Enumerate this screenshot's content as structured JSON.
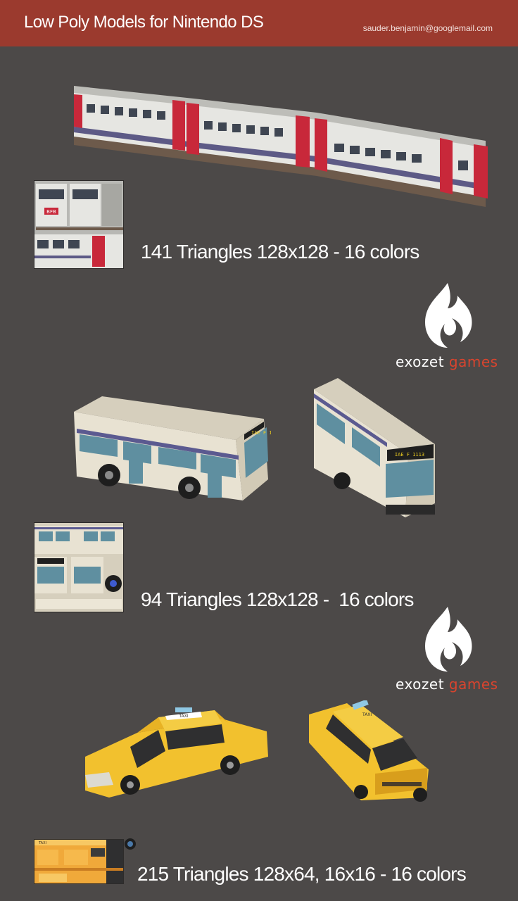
{
  "header": {
    "title": "Low Poly Models for Nintendo DS",
    "email": "sauder.benjamin@googlemail.com"
  },
  "models": [
    {
      "name": "train",
      "caption": "141 Triangles 128x128 - 16 colors",
      "texture_label": "BFB"
    },
    {
      "name": "bus",
      "caption": "94 Triangles 128x128 -  16 colors",
      "texture_label": "IAE F 1113"
    },
    {
      "name": "taxi",
      "caption": "215 Triangles 128x64, 16x16 - 16 colors",
      "texture_label": "TAXI"
    }
  ],
  "logo": {
    "word1": "exozet",
    "word2": "games"
  },
  "colors": {
    "background": "#4c4948",
    "header": "#9b3a2e",
    "logo_accent": "#d9442e",
    "train_red": "#c8283a",
    "taxi_yellow": "#f2c12e",
    "bus_white": "#e8e2d2"
  }
}
